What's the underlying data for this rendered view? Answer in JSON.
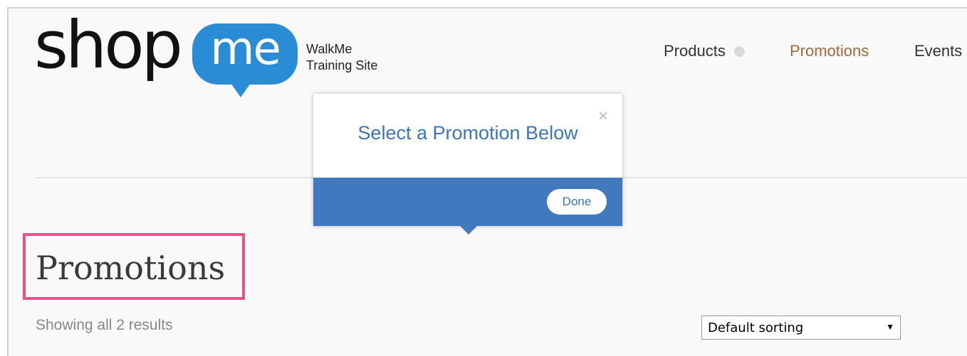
{
  "logo": {
    "shop": "shop",
    "me": "me",
    "tagline_line1": "WalkMe",
    "tagline_line2": "Training Site"
  },
  "nav": {
    "products": "Products",
    "promotions": "Promotions",
    "events": "Events"
  },
  "popup": {
    "title": "Select a Promotion Below",
    "close": "×",
    "done": "Done"
  },
  "page": {
    "title": "Promotions",
    "results_text": "Showing all 2 results"
  },
  "sorting": {
    "selected": "Default sorting",
    "arrow": "▼"
  },
  "colors": {
    "brand_blue": "#2b8cd6",
    "popup_blue": "#4179bf",
    "nav_active": "#a06a3c",
    "highlight": "#e3558a"
  }
}
